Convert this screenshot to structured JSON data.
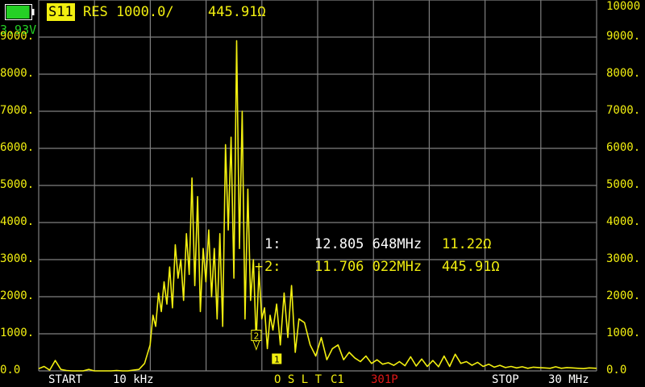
{
  "status": {
    "battery_voltage": "3.93V",
    "battery_level": 0.95,
    "trace_label": "S11",
    "format_label": "RES 1000.0/",
    "active_value": "445.91Ω"
  },
  "markers": [
    {
      "prefix": " ",
      "id": "1:",
      "freq": "12.805 648MHz",
      "value": "11.22Ω"
    },
    {
      "prefix": "+",
      "id": "2:",
      "freq": "11.706 022MHz",
      "value": "445.91Ω"
    }
  ],
  "footer": {
    "start_label": "START",
    "start_value": "10 kHz",
    "cal_label": "O S L T",
    "cal_set": "C1",
    "points": "301P",
    "stop_label": "STOP",
    "stop_value": "30 MHz"
  },
  "colors": {
    "trace": "#f2ef10",
    "grid": "#7f7f7f",
    "points": "#e01818",
    "battery": "#25d025"
  },
  "chart_data": {
    "type": "line",
    "y_ticks_left": [
      "0.0",
      "1000.",
      "2000.",
      "3000.",
      "4000.",
      "5000.",
      "6000.",
      "7000.",
      "8000.",
      "9000."
    ],
    "y_ticks_right": [
      "0.0",
      "1000.",
      "2000.",
      "3000.",
      "4000.",
      "5000.",
      "6000.",
      "7000.",
      "8000.",
      "9000.",
      "10000"
    ],
    "ylim": [
      0,
      10000
    ],
    "xlim_mhz": [
      0.01,
      30
    ],
    "grid": true,
    "series": [
      {
        "x": [
          0.01,
          0.3,
          0.6,
          0.9,
          1.2,
          1.5,
          1.8,
          2.1,
          2.4,
          2.7,
          3.0,
          3.3,
          3.6,
          3.9,
          4.2,
          4.5,
          4.8,
          5.1,
          5.4,
          5.7,
          6.0,
          6.15,
          6.3,
          6.45,
          6.6,
          6.75,
          6.9,
          7.05,
          7.2,
          7.35,
          7.5,
          7.65,
          7.8,
          7.95,
          8.1,
          8.25,
          8.4,
          8.55,
          8.7,
          8.85,
          9.0,
          9.15,
          9.3,
          9.45,
          9.6,
          9.75,
          9.9,
          10.05,
          10.2,
          10.35,
          10.5,
          10.65,
          10.8,
          10.95,
          11.1,
          11.25,
          11.4,
          11.55,
          11.7,
          11.85,
          12.0,
          12.15,
          12.3,
          12.45,
          12.6,
          12.8,
          13.0,
          13.2,
          13.4,
          13.6,
          13.8,
          14.0,
          14.3,
          14.6,
          14.9,
          15.2,
          15.5,
          15.8,
          16.1,
          16.4,
          16.7,
          17.0,
          17.3,
          17.6,
          17.9,
          18.2,
          18.5,
          18.8,
          19.1,
          19.4,
          19.7,
          20.0,
          20.3,
          20.6,
          20.9,
          21.2,
          21.5,
          21.8,
          22.1,
          22.4,
          22.7,
          23.0,
          23.3,
          23.6,
          23.9,
          24.2,
          24.5,
          24.8,
          25.1,
          25.4,
          25.7,
          26.0,
          26.3,
          26.6,
          26.9,
          27.2,
          27.5,
          27.8,
          28.1,
          28.4,
          28.7,
          29.0,
          29.3,
          29.6,
          30.0
        ],
        "y": [
          60,
          120,
          20,
          280,
          40,
          10,
          0,
          0,
          0,
          40,
          0,
          0,
          0,
          0,
          10,
          0,
          0,
          20,
          40,
          200,
          700,
          1500,
          1200,
          2100,
          1600,
          2400,
          1800,
          2800,
          1700,
          3400,
          2500,
          3000,
          1900,
          3700,
          2600,
          5200,
          2300,
          4700,
          1600,
          3300,
          2400,
          3800,
          2000,
          3300,
          1400,
          3700,
          1200,
          6100,
          3800,
          6300,
          2500,
          8900,
          3300,
          7000,
          1400,
          4900,
          1900,
          3000,
          800,
          2700,
          1400,
          1700,
          600,
          1500,
          1100,
          1800,
          700,
          2100,
          900,
          2300,
          500,
          1400,
          1300,
          700,
          400,
          900,
          300,
          600,
          700,
          300,
          500,
          350,
          250,
          400,
          200,
          300,
          180,
          220,
          150,
          250,
          140,
          380,
          130,
          320,
          120,
          280,
          110,
          400,
          120,
          450,
          200,
          250,
          150,
          230,
          120,
          180,
          100,
          150,
          90,
          120,
          80,
          110,
          70,
          100,
          90,
          80,
          70,
          110,
          70,
          90,
          80,
          70,
          60,
          80,
          70
        ]
      }
    ]
  }
}
